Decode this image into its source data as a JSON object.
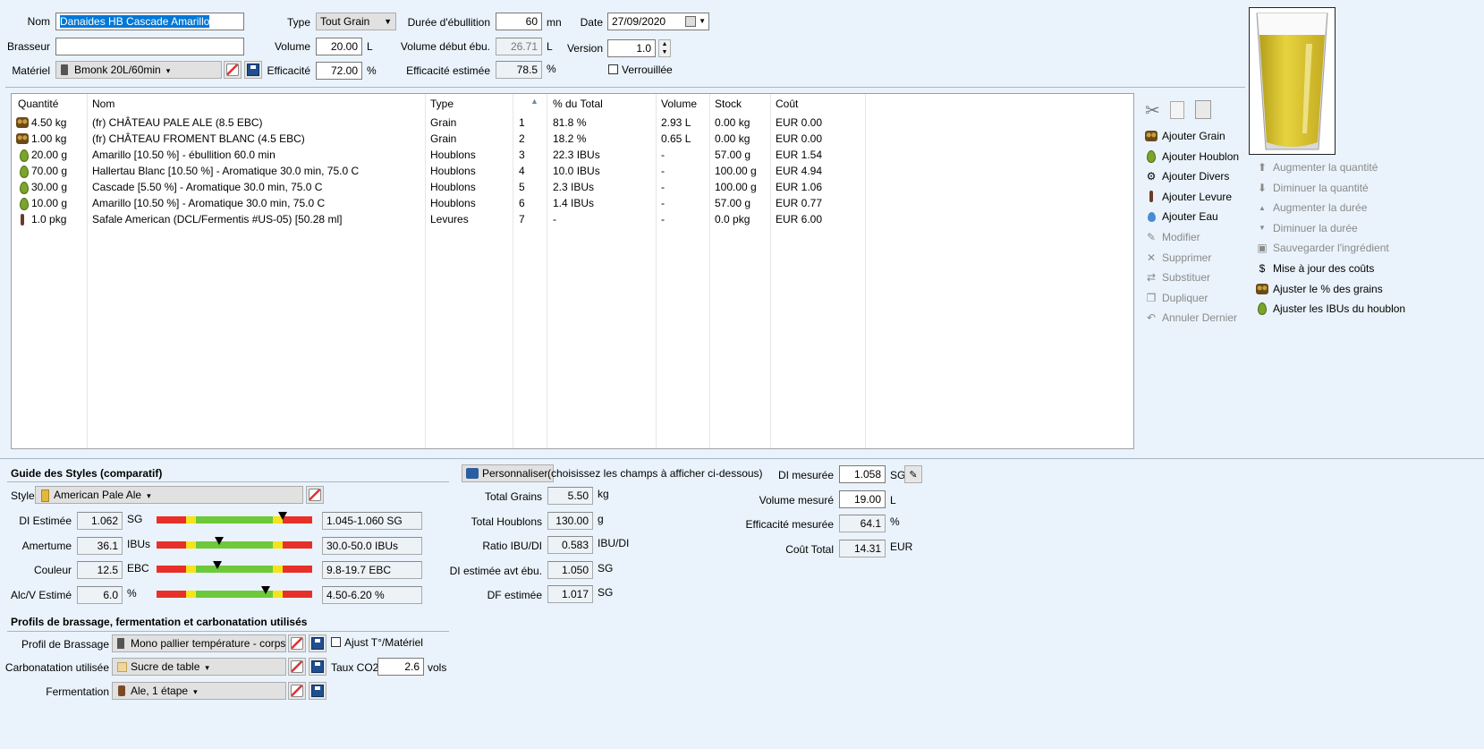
{
  "header": {
    "nom_label": "Nom",
    "nom_value": "Danaides HB Cascade Amarillo",
    "brasseur_label": "Brasseur",
    "brasseur_value": "",
    "materiel_label": "Matériel",
    "materiel_value": "Bmonk 20L/60min",
    "type_label": "Type",
    "type_value": "Tout Grain",
    "volume_label": "Volume",
    "volume_value": "20.00",
    "volume_unit": "L",
    "efficacite_label": "Efficacité",
    "efficacite_value": "72.00",
    "efficacite_unit": "%",
    "duree_label": "Durée d'ébullition",
    "duree_value": "60",
    "duree_unit": "mn",
    "vol_debut_label": "Volume début ébu.",
    "vol_debut_value": "26.71",
    "vol_debut_unit": "L",
    "eff_est_label": "Efficacité estimée",
    "eff_est_value": "78.5",
    "eff_est_unit": "%",
    "date_label": "Date",
    "date_value": "27/09/2020",
    "version_label": "Version",
    "version_value": "1.0",
    "verrouillee_label": "Verrouillée"
  },
  "table": {
    "columns": [
      "Quantité",
      "Nom",
      "Type",
      "",
      "% du Total",
      "Volume",
      "Stock",
      "Coût"
    ],
    "rows": [
      {
        "icon": "grain",
        "qty": "4.50 kg",
        "name": "(fr) CHÂTEAU PALE ALE (8.5 EBC)",
        "type": "Grain",
        "n": "1",
        "pct": "81.8 %",
        "vol": "2.93 L",
        "stock": "0.00 kg",
        "cost": "EUR 0.00"
      },
      {
        "icon": "grain",
        "qty": "1.00 kg",
        "name": "(fr) CHÂTEAU FROMENT BLANC (4.5 EBC)",
        "type": "Grain",
        "n": "2",
        "pct": "18.2 %",
        "vol": "0.65 L",
        "stock": "0.00 kg",
        "cost": "EUR 0.00"
      },
      {
        "icon": "hop",
        "qty": "20.00 g",
        "name": "Amarillo [10.50 %] - ébullition 60.0 min",
        "type": "Houblons",
        "n": "3",
        "pct": "22.3 IBUs",
        "vol": "-",
        "stock": "57.00 g",
        "cost": "EUR 1.54"
      },
      {
        "icon": "hop",
        "qty": "70.00 g",
        "name": "Hallertau Blanc [10.50 %] - Aromatique  30.0 min, 75.0 C",
        "type": "Houblons",
        "n": "4",
        "pct": "10.0 IBUs",
        "vol": "-",
        "stock": "100.00 g",
        "cost": "EUR 4.94"
      },
      {
        "icon": "hop",
        "qty": "30.00 g",
        "name": "Cascade [5.50 %] - Aromatique  30.0 min, 75.0 C",
        "type": "Houblons",
        "n": "5",
        "pct": "2.3 IBUs",
        "vol": "-",
        "stock": "100.00 g",
        "cost": "EUR 1.06"
      },
      {
        "icon": "hop",
        "qty": "10.00 g",
        "name": "Amarillo [10.50 %] - Aromatique  30.0 min, 75.0 C",
        "type": "Houblons",
        "n": "6",
        "pct": "1.4 IBUs",
        "vol": "-",
        "stock": "57.00 g",
        "cost": "EUR 0.77"
      },
      {
        "icon": "yeast",
        "qty": "1.0 pkg",
        "name": "Safale American  (DCL/Fermentis #US-05) [50.28 ml]",
        "type": "Levures",
        "n": "7",
        "pct": "-",
        "vol": "-",
        "stock": "0.0 pkg",
        "cost": "EUR 6.00"
      }
    ]
  },
  "actions_left": [
    {
      "label": "Ajouter Grain",
      "icon": "grain-icon",
      "enabled": true
    },
    {
      "label": "Ajouter Houblon",
      "icon": "hop-icon",
      "enabled": true
    },
    {
      "label": "Ajouter Divers",
      "icon": "misc-icon",
      "enabled": true
    },
    {
      "label": "Ajouter Levure",
      "icon": "yeast-icon",
      "enabled": true
    },
    {
      "label": "Ajouter Eau",
      "icon": "water-drop-icon",
      "enabled": true
    },
    {
      "label": "Modifier",
      "icon": "edit-icon",
      "enabled": false
    },
    {
      "label": "Supprimer",
      "icon": "delete-icon",
      "enabled": false
    },
    {
      "label": "Substituer",
      "icon": "substitute-icon",
      "enabled": false
    },
    {
      "label": "Dupliquer",
      "icon": "duplicate-icon",
      "enabled": false
    },
    {
      "label": "Annuler Dernier",
      "icon": "undo-icon",
      "enabled": false
    }
  ],
  "actions_right": [
    {
      "label": "Augmenter la quantité",
      "icon": "arrow-up-icon",
      "enabled": false
    },
    {
      "label": "Diminuer la quantité",
      "icon": "arrow-down-icon",
      "enabled": false
    },
    {
      "label": "Augmenter la durée",
      "icon": "triangle-up-icon",
      "enabled": false
    },
    {
      "label": "Diminuer la durée",
      "icon": "triangle-down-icon",
      "enabled": false
    },
    {
      "label": "Sauvegarder l'ingrédient",
      "icon": "save-icon",
      "enabled": false
    },
    {
      "label": "Mise à jour des coûts",
      "icon": "dollar-icon",
      "enabled": true
    },
    {
      "label": "Ajuster le % des grains",
      "icon": "grain-icon",
      "enabled": true
    },
    {
      "label": "Ajuster les IBUs du houblon",
      "icon": "hop-icon",
      "enabled": true
    }
  ],
  "styles": {
    "title": "Guide des Styles (comparatif)",
    "style_label": "Style",
    "style_value": "American Pale Ale",
    "rows": [
      {
        "label": "DI Estimée",
        "value": "1.062",
        "unit": "SG",
        "range": "1.045-1.060 SG",
        "marker": 0.81
      },
      {
        "label": "Amertume",
        "value": "36.1",
        "unit": "IBUs",
        "range": "30.0-50.0 IBUs",
        "marker": 0.4
      },
      {
        "label": "Couleur",
        "value": "12.5",
        "unit": "EBC",
        "range": "9.8-19.7 EBC",
        "marker": 0.39
      },
      {
        "label": "Alc/V Estimé",
        "value": "6.0",
        "unit": "%",
        "range": "4.50-6.20 %",
        "marker": 0.7
      }
    ]
  },
  "profiles": {
    "title": "Profils de brassage, fermentation et carbonatation utilisés",
    "brassage_label": "Profil de Brassage",
    "brassage_value": "Mono pallier température - corps m",
    "ajust_label": "Ajust T°/Matériel",
    "carbo_label": "Carbonatation utilisée",
    "carbo_value": "Sucre de table",
    "taux_label": "Taux CO2",
    "taux_value": "2.6",
    "taux_unit": "vols",
    "ferm_label": "Fermentation",
    "ferm_value": "Ale, 1 étape"
  },
  "stats": {
    "personnaliser_label": "Personnaliser",
    "hint": "(choisissez les champs à afficher ci-dessous)",
    "rows": [
      {
        "label": "Total Grains",
        "value": "5.50",
        "unit": "kg"
      },
      {
        "label": "Total Houblons",
        "value": "130.00",
        "unit": "g"
      },
      {
        "label": "Ratio IBU/DI",
        "value": "0.583",
        "unit": "IBU/DI"
      },
      {
        "label": "DI estimée avt ébu.",
        "value": "1.050",
        "unit": "SG"
      },
      {
        "label": "DF estimée",
        "value": "1.017",
        "unit": "SG"
      }
    ]
  },
  "measured": {
    "rows": [
      {
        "label": "DI mesurée",
        "value": "1.058",
        "unit": "SG",
        "editable": true
      },
      {
        "label": "Volume mesuré",
        "value": "19.00",
        "unit": "L",
        "editable": true
      },
      {
        "label": "Efficacité mesurée",
        "value": "64.1",
        "unit": "%",
        "editable": false
      },
      {
        "label": "Coût Total",
        "value": "14.31",
        "unit": "EUR",
        "editable": false
      }
    ]
  }
}
